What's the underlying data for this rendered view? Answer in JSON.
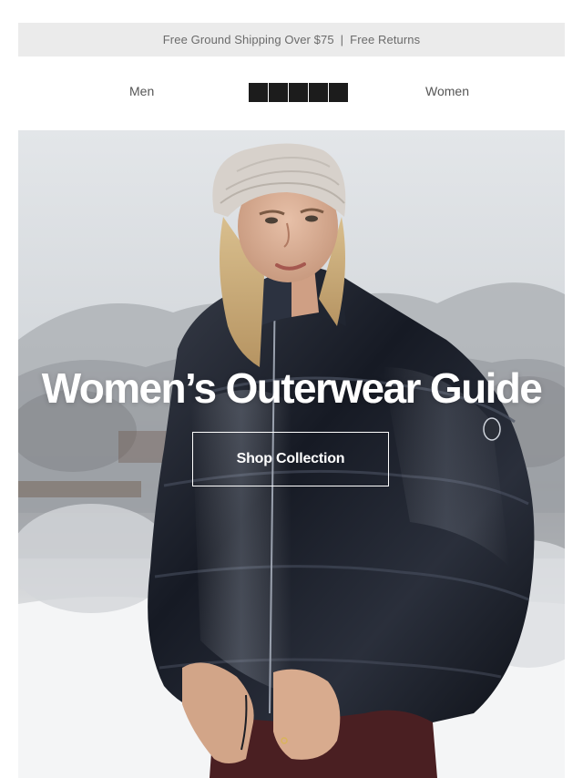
{
  "promo": {
    "shipping_text": "Free Ground Shipping Over $75",
    "separator": "|",
    "returns_text": "Free Returns"
  },
  "nav": {
    "men_label": "Men",
    "women_label": "Women",
    "logo_icon": "brand-logo-blocks"
  },
  "hero": {
    "title": "Women’s Outerwear Guide",
    "cta_label": "Shop Collection",
    "image_subject": "woman in glossy black puffer jacket and cream beanie in snowy landscape"
  },
  "colors": {
    "promo_background": "#ebebeb",
    "promo_text": "#6b6b6b",
    "nav_text": "#555555",
    "logo": "#1c1c1c",
    "hero_text": "#ffffff"
  }
}
